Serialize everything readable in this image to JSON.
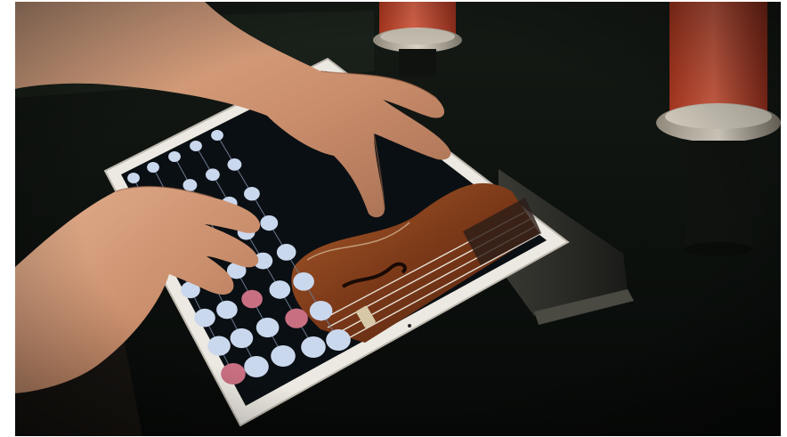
{
  "scene": {
    "description_icon": "photo-icon",
    "colors": {
      "background": "#0c0f0d",
      "tablet_frame": "#e9e6df",
      "screen": "#0a0f13",
      "note_button": "#cad8ee",
      "note_button_active": "#c86f82",
      "violin_wood": "#7a3a1a",
      "lamp_glass": "#c24b33",
      "lamp_base": "#b9b3a6",
      "skin": "#d9a07f"
    },
    "note_buttons_total": 40,
    "active_note_buttons": 3
  }
}
